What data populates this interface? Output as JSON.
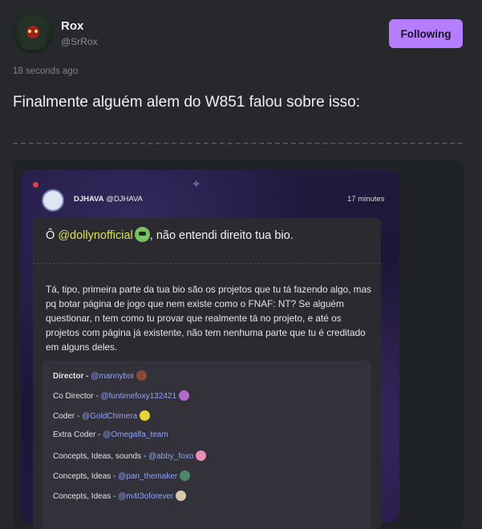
{
  "header": {
    "username": "Rox",
    "handle": "@SrRox",
    "follow_label": "Following"
  },
  "post": {
    "time": "18 seconds ago",
    "text": "Finalmente alguém alem do W851 falou sobre isso:"
  },
  "embed": {
    "author_name": "DJHAVA",
    "author_handle": "@DJHAVA",
    "time": "17 minutes",
    "greeting_prefix": "Ô ",
    "greeting_mention": "@dollynofficial",
    "greeting_suffix": ", não entendi direito tua bio.",
    "body": "Tá, tipo, primeira parte da tua bio são os projetos que tu tá fazendo algo, mas pq botar página de jogo que nem existe como o FNAF: NT? Se alguém questionar, n tem como tu provar que realmente tá no projeto, e até os projetos com página já existente, não tem nenhuma parte que tu é creditado em alguns deles.",
    "credits": [
      {
        "role": "Director - ",
        "mention": "@mannyboi"
      },
      {
        "role": "Co Director - ",
        "mention": "@funtimefoxy132421"
      },
      {
        "role": "Coder - ",
        "mention": "@GoldChimera"
      },
      {
        "role": "Extra Coder - ",
        "mention": "@Omegalfa_team"
      },
      {
        "role": "Concepts, Ideas, sounds - ",
        "mention": "@abby_foxo"
      },
      {
        "role": "Concepts, Ideas - ",
        "mention": "@pan_themaker"
      },
      {
        "role": "Concepts, Ideas - ",
        "mention": "@m4t3oforever"
      }
    ]
  },
  "colors": {
    "accent": "#b57dff",
    "mention_link": "#8ea2ff",
    "mention_highlight": "#d8e25a",
    "background": "#26282b"
  },
  "icons": {
    "sparkle": "✦"
  }
}
